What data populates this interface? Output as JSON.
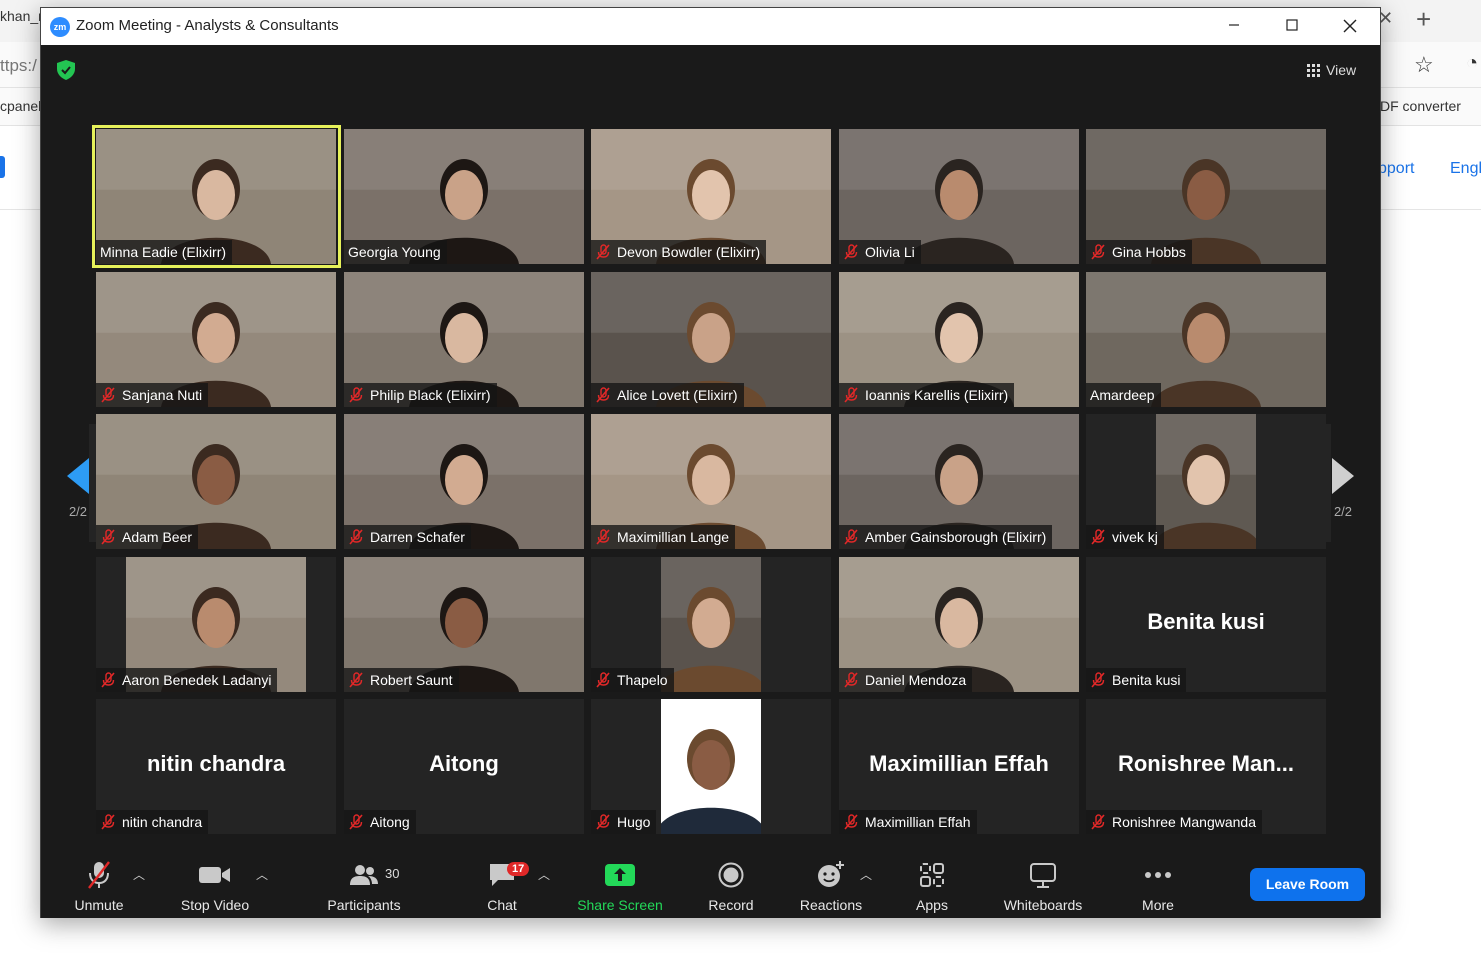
{
  "background_browser": {
    "tab_fragment": "khan_r",
    "address_fragment": "ttps:/",
    "bookmark_left": "cpanel",
    "bookmark_right": "DF converter",
    "nav_support": "pport",
    "nav_lang": "Engl"
  },
  "window": {
    "logo": "zm",
    "title": "Zoom Meeting - Analysts & Consultants"
  },
  "header": {
    "view_label": "View",
    "security_icon": "green-shield-check"
  },
  "paging": {
    "left_label": "2/2",
    "right_label": "2/2"
  },
  "participants": [
    {
      "name": "Minna Eadie (Elixirr)",
      "muted": false,
      "video": true,
      "speaking": true
    },
    {
      "name": "Georgia Young",
      "muted": false,
      "video": true
    },
    {
      "name": "Devon Bowdler (Elixirr)",
      "muted": true,
      "video": true
    },
    {
      "name": "Olivia Li",
      "muted": true,
      "video": true
    },
    {
      "name": "Gina Hobbs",
      "muted": true,
      "video": true
    },
    {
      "name": "Sanjana Nuti",
      "muted": true,
      "video": true
    },
    {
      "name": "Philip Black (Elixirr)",
      "muted": true,
      "video": true
    },
    {
      "name": "Alice Lovett (Elixirr)",
      "muted": true,
      "video": true
    },
    {
      "name": "Ioannis Karellis (Elixirr)",
      "muted": true,
      "video": true
    },
    {
      "name": "Amardeep",
      "muted": false,
      "video": true
    },
    {
      "name": "Adam Beer",
      "muted": true,
      "video": true
    },
    {
      "name": "Darren Schafer",
      "muted": true,
      "video": true
    },
    {
      "name": "Maximillian Lange",
      "muted": true,
      "video": true
    },
    {
      "name": "Amber Gainsborough (Elixirr)",
      "muted": true,
      "video": true
    },
    {
      "name": "vivek kj",
      "muted": true,
      "video": true,
      "narrow": true
    },
    {
      "name": "Aaron Benedek Ladanyi",
      "muted": true,
      "video": true,
      "wide_inset": true
    },
    {
      "name": "Robert Saunt",
      "muted": true,
      "video": true
    },
    {
      "name": "Thapelo",
      "muted": true,
      "video": true,
      "narrow": true
    },
    {
      "name": "Daniel Mendoza",
      "muted": true,
      "video": true
    },
    {
      "name": "Benita kusi",
      "display_name": "Benita kusi",
      "muted": true,
      "video": false
    },
    {
      "name": "nitin chandra",
      "display_name": "nitin chandra",
      "muted": true,
      "video": false
    },
    {
      "name": "Aitong",
      "display_name": "Aitong",
      "muted": true,
      "video": false
    },
    {
      "name": "Hugo",
      "muted": true,
      "video": true,
      "photo": true
    },
    {
      "name": "Maximillian Effah",
      "display_name": "Maximillian Effah",
      "muted": true,
      "video": false
    },
    {
      "name": "Ronishree Mangwanda",
      "display_name": "Ronishree  Man...",
      "muted": true,
      "video": false
    }
  ],
  "toolbar": {
    "unmute": "Unmute",
    "stop_video": "Stop Video",
    "participants": "Participants",
    "participants_count": "30",
    "chat": "Chat",
    "chat_badge": "17",
    "share_screen": "Share Screen",
    "record": "Record",
    "reactions": "Reactions",
    "apps": "Apps",
    "whiteboards": "Whiteboards",
    "more": "More",
    "leave": "Leave Room"
  },
  "colors": {
    "speaking_border": "#e6f15a",
    "share_green": "#23d959",
    "leave_blue": "#0e72ed",
    "muted_red": "#e02828",
    "zoom_blue": "#2d8cff"
  }
}
